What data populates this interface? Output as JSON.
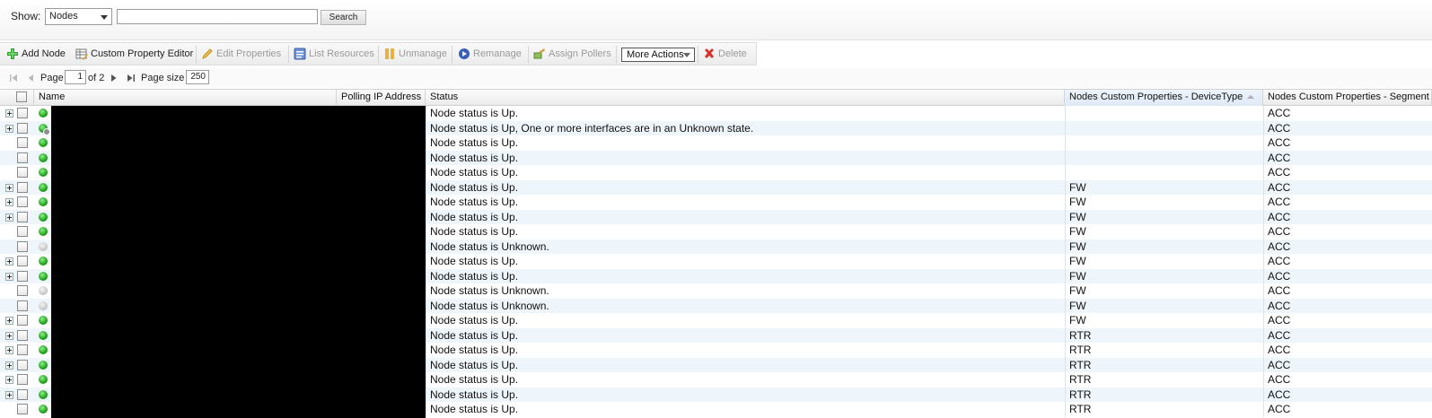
{
  "search": {
    "show_label": "Show:",
    "show_value": "Nodes",
    "query": "",
    "button_label": "Search"
  },
  "toolbar": {
    "add_node": "Add Node",
    "custom_property_editor": "Custom Property Editor",
    "edit_properties": "Edit Properties",
    "list_resources": "List Resources",
    "unmanage": "Unmanage",
    "remanage": "Remanage",
    "assign_pollers": "Assign Pollers",
    "more_actions": "More Actions",
    "delete": "Delete"
  },
  "pager": {
    "page_label": "Page",
    "page_value": "1",
    "of_label": "of 2",
    "size_label": "Page size",
    "size_value": "250"
  },
  "columns": {
    "name": "Name",
    "polling_ip": "Polling IP Address",
    "status": "Status",
    "device_type": "Nodes Custom Properties - DeviceType",
    "segment": "Nodes Custom Properties - Segment"
  },
  "rows": [
    {
      "expand": true,
      "status": "up",
      "status_text": "Node status is Up.",
      "device_type": "",
      "segment": "ACC"
    },
    {
      "expand": true,
      "status": "warn",
      "status_text": "Node status is Up, One or more interfaces are in an Unknown state.",
      "device_type": "",
      "segment": "ACC"
    },
    {
      "expand": false,
      "status": "up",
      "status_text": "Node status is Up.",
      "device_type": "",
      "segment": "ACC"
    },
    {
      "expand": false,
      "status": "up",
      "status_text": "Node status is Up.",
      "device_type": "",
      "segment": "ACC"
    },
    {
      "expand": false,
      "status": "up",
      "status_text": "Node status is Up.",
      "device_type": "",
      "segment": "ACC"
    },
    {
      "expand": true,
      "status": "up",
      "status_text": "Node status is Up.",
      "device_type": "FW",
      "segment": "ACC"
    },
    {
      "expand": true,
      "status": "up",
      "status_text": "Node status is Up.",
      "device_type": "FW",
      "segment": "ACC"
    },
    {
      "expand": true,
      "status": "up",
      "status_text": "Node status is Up.",
      "device_type": "FW",
      "segment": "ACC"
    },
    {
      "expand": false,
      "status": "up",
      "status_text": "Node status is Up.",
      "device_type": "FW",
      "segment": "ACC"
    },
    {
      "expand": false,
      "status": "unknown",
      "status_text": "Node status is Unknown.",
      "device_type": "FW",
      "segment": "ACC"
    },
    {
      "expand": true,
      "status": "up",
      "status_text": "Node status is Up.",
      "device_type": "FW",
      "segment": "ACC"
    },
    {
      "expand": true,
      "status": "up",
      "status_text": "Node status is Up.",
      "device_type": "FW",
      "segment": "ACC"
    },
    {
      "expand": false,
      "status": "unknown",
      "status_text": "Node status is Unknown.",
      "device_type": "FW",
      "segment": "ACC"
    },
    {
      "expand": false,
      "status": "unknown",
      "status_text": "Node status is Unknown.",
      "device_type": "FW",
      "segment": "ACC"
    },
    {
      "expand": true,
      "status": "up",
      "status_text": "Node status is Up.",
      "device_type": "FW",
      "segment": "ACC"
    },
    {
      "expand": true,
      "status": "up",
      "status_text": "Node status is Up.",
      "device_type": "RTR",
      "segment": "ACC"
    },
    {
      "expand": true,
      "status": "up",
      "status_text": "Node status is Up.",
      "device_type": "RTR",
      "segment": "ACC"
    },
    {
      "expand": true,
      "status": "up",
      "status_text": "Node status is Up.",
      "device_type": "RTR",
      "segment": "ACC"
    },
    {
      "expand": true,
      "status": "up",
      "status_text": "Node status is Up.",
      "device_type": "RTR",
      "segment": "ACC"
    },
    {
      "expand": true,
      "status": "up",
      "status_text": "Node status is Up.",
      "device_type": "RTR",
      "segment": "ACC"
    },
    {
      "expand": false,
      "status": "up",
      "status_text": "Node status is Up.",
      "device_type": "RTR",
      "segment": "ACC"
    }
  ],
  "colors": {
    "status_up": "#1fa31a",
    "status_unknown": "#c9c9c9",
    "row_alt": "#eef6fc",
    "redaction": "#000000"
  },
  "icons": {
    "add_node": "green-plus-icon",
    "custom_property_editor": "table-edit-icon",
    "edit_properties": "pencil-icon",
    "list_resources": "list-icon",
    "unmanage": "pause-icon",
    "remanage": "play-icon",
    "assign_pollers": "poller-icon",
    "delete": "red-x-icon"
  }
}
